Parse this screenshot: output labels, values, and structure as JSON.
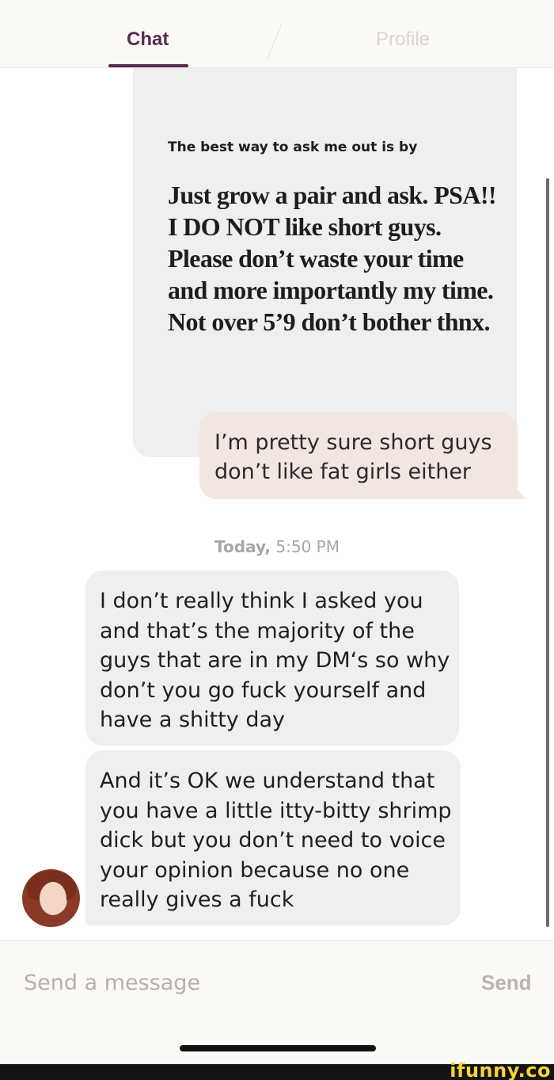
{
  "tabs": {
    "chat": "Chat",
    "profile": "Profile"
  },
  "prompt": {
    "question": "The best way to ask me out is by",
    "answer": "Just grow a pair and ask. PSA!! I DO NOT like short guys. Please don’t waste your time and more importantly my time. Not over 5’9 don’t bother thnx."
  },
  "messages": {
    "sent_1": "I’m pretty sure short guys don’t like fat girls either",
    "timestamp_day": "Today,",
    "timestamp_time": "5:50 PM",
    "received_1": "I don’t really think I asked you and that’s the majority of the guys that are in my DM‘s so why don’t you go fuck yourself and have a shitty day",
    "received_2": "And it’s OK we understand that you have a little itty-bitty shrimp dick but you don’t need to voice your opinion because no one really gives a fuck"
  },
  "composer": {
    "placeholder": "Send a message",
    "send_label": "Send"
  },
  "watermark": "ifunny.co",
  "colors": {
    "accent": "#5a2a4e",
    "sent_bubble": "#f1e6e1",
    "received_bubble": "#efefef"
  }
}
